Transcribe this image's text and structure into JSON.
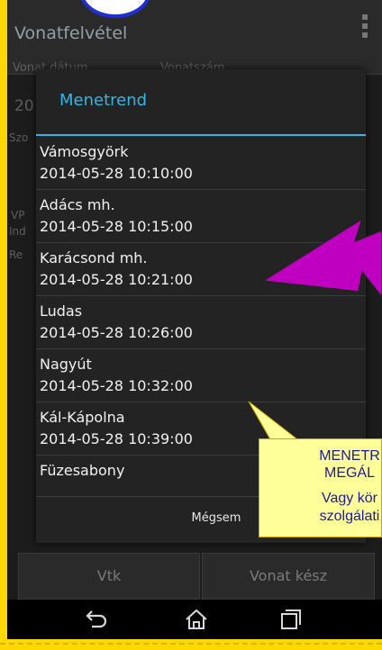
{
  "app": {
    "title": "Vonatfelvétel",
    "field_labels": [
      "Vonat dátum",
      "Vonatszám"
    ],
    "fragment_labels": [
      "20",
      "Szo",
      "VP",
      "Ind",
      "Re"
    ],
    "bottom_buttons": [
      "Vtk",
      "Vonat kész"
    ]
  },
  "dialog": {
    "title": "Menetrend",
    "stops": [
      {
        "station": "Vámosgyörk",
        "time": "2014-05-28 10:10:00"
      },
      {
        "station": "Adács mh.",
        "time": "2014-05-28 10:15:00"
      },
      {
        "station": "Karácsond mh.",
        "time": "2014-05-28 10:21:00"
      },
      {
        "station": "Ludas",
        "time": "2014-05-28 10:26:00"
      },
      {
        "station": "Nagyút",
        "time": "2014-05-28 10:32:00"
      },
      {
        "station": "Kál-Kápolna",
        "time": "2014-05-28 10:39:00"
      },
      {
        "station": "Füzesabony",
        "time": ""
      }
    ],
    "cancel_label": "Mégsem"
  },
  "annotation": {
    "callout_lines": [
      "MENETR",
      "MEGÁL",
      "Vagy kör",
      "szolgálati"
    ]
  },
  "navbar": {
    "icons": [
      "back-icon",
      "home-icon",
      "recent-apps-icon"
    ]
  },
  "colors": {
    "accent": "#33b5e5",
    "frame": "#ffd800",
    "arrow": "#c000c0",
    "callout_bg": "#ffff99",
    "callout_text": "#1a1aa6"
  }
}
